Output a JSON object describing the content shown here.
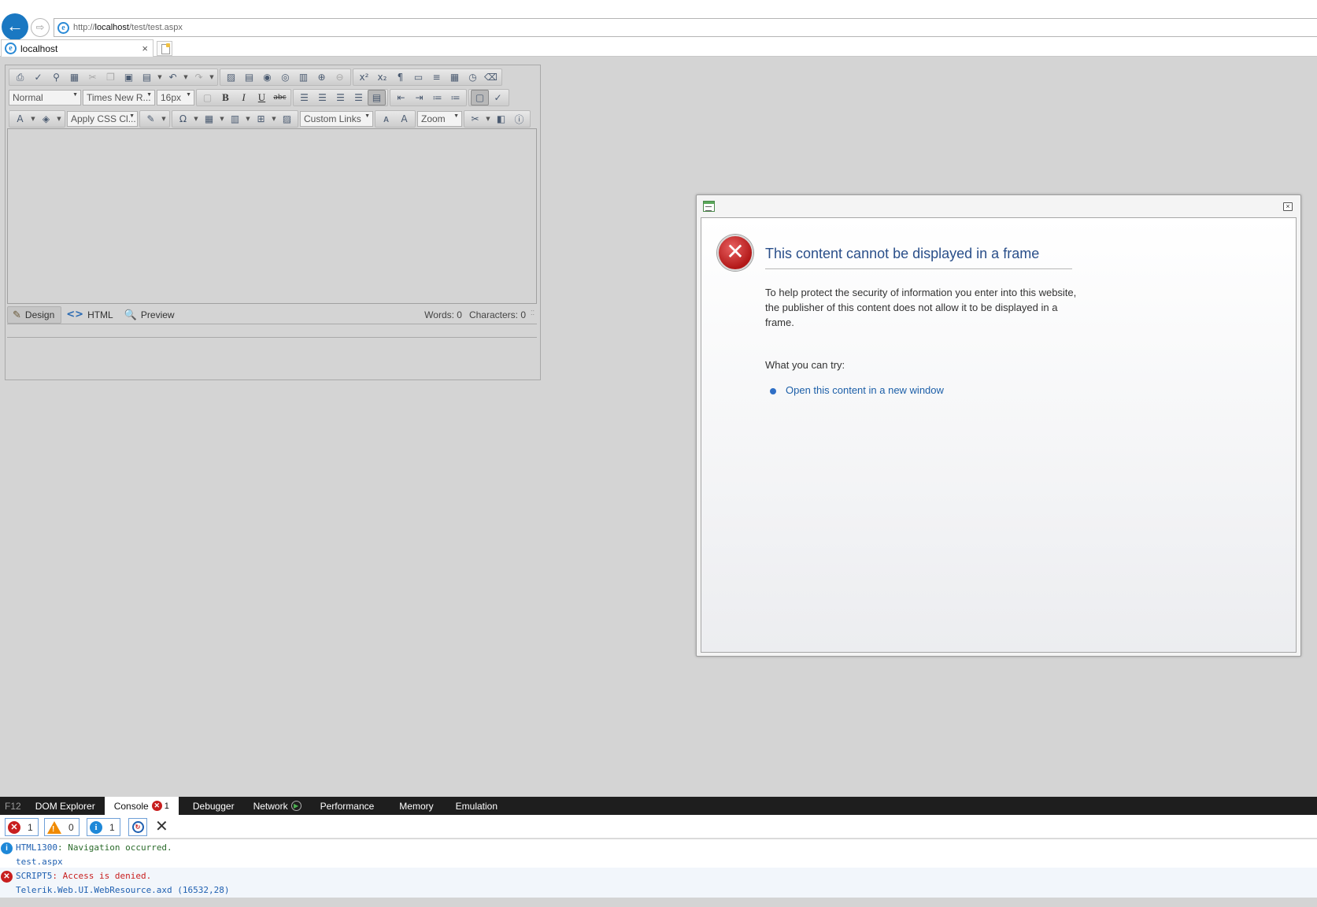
{
  "browser": {
    "url_prefix": "http://",
    "url_host": "localhost",
    "url_path": "/test/test.aspx",
    "tab_title": "localhost",
    "tab_close": "×",
    "ie_glyph": "e",
    "back_glyph": "←",
    "forward_glyph": "⇨"
  },
  "editor": {
    "paragraph_style": "Normal",
    "font_name": "Times New R...",
    "font_size": "16px",
    "css_class": "Apply CSS Cl...",
    "custom_links": "Custom Links",
    "zoom": "Zoom",
    "modes": {
      "design": "Design",
      "html": "HTML",
      "preview": "Preview"
    },
    "words_label": "Words: 0",
    "characters_label": "Characters: 0",
    "mode_icons": {
      "design": "✎",
      "html": "<>",
      "preview": "🔍"
    }
  },
  "dialog": {
    "heading": "This content cannot be displayed in a frame",
    "paragraph": "To help protect the security of information you enter into this website, the publisher of this content does not allow it to be displayed in a frame.",
    "try_label": "What you can try:",
    "link": "Open this content in a new window",
    "close_glyph": "×",
    "error_glyph": "✕"
  },
  "devtools": {
    "tabs": {
      "f12": "F12",
      "dom": "DOM Explorer",
      "console": "Console",
      "console_error_count": "1",
      "debugger": "Debugger",
      "network": "Network",
      "performance": "Performance",
      "memory": "Memory",
      "emulation": "Emulation"
    },
    "filters": {
      "errors": "1",
      "warnings": "0",
      "messages": "1"
    },
    "clear_glyph": "✕",
    "messages": [
      {
        "type": "info",
        "code": "HTML1300",
        "text": ": Navigation occurred.",
        "source": "test.aspx"
      },
      {
        "type": "error",
        "code": "SCRIPT5",
        "text": ": Access is denied.",
        "source": "Telerik.Web.UI.WebResource.axd (16532,28)"
      }
    ]
  },
  "colors": {
    "accent_blue": "#1a78c2",
    "link_blue": "#1c5fa8",
    "error_red": "#c81e1e",
    "devtools_bg": "#1e1e1e",
    "page_bg": "#d4d4d4"
  }
}
